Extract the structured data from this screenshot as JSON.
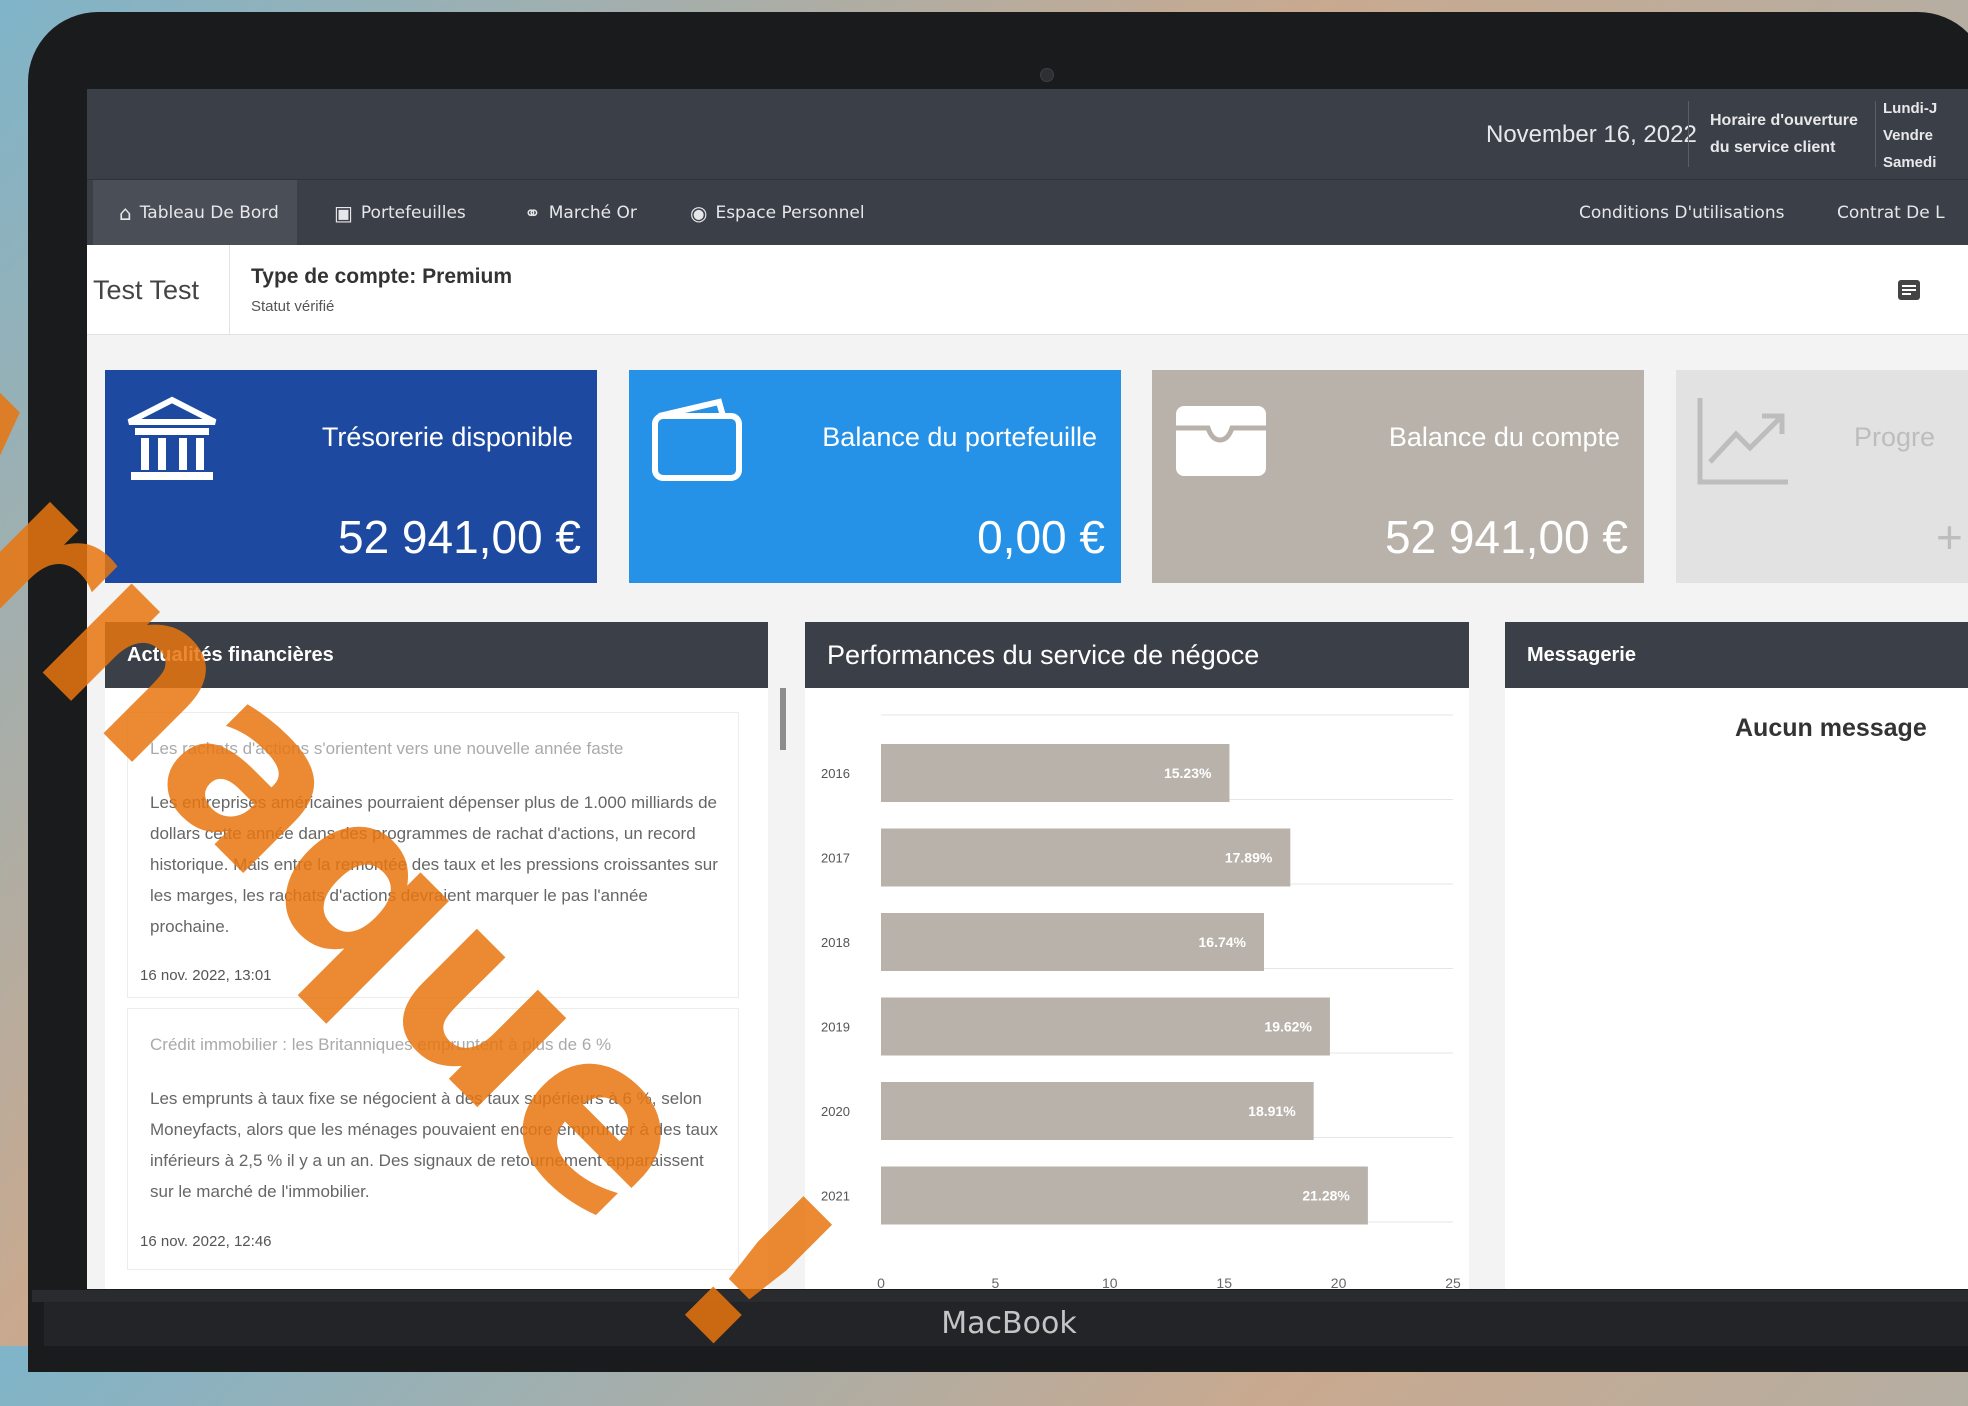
{
  "device_label": "MacBook",
  "header": {
    "date": "November 16, 2022",
    "hours_title": "Horaire d'ouverture du service client",
    "hours_days": [
      "Lundi-J",
      "Vendre",
      "Samedi"
    ]
  },
  "nav": {
    "items": [
      {
        "label": "Tableau De Bord",
        "icon": "home-icon",
        "active": true
      },
      {
        "label": "Portefeuilles",
        "icon": "wallet-icon"
      },
      {
        "label": "Marché Or",
        "icon": "gold-icon"
      },
      {
        "label": "Espace Personnel",
        "icon": "user-circle-icon"
      }
    ],
    "right_items": [
      "Conditions D'utilisations",
      "Contrat De L"
    ]
  },
  "account": {
    "name": "Test Test",
    "type": "Type de compte: Premium",
    "status": "Statut vérifié"
  },
  "cards": [
    {
      "title": "Trésorerie disponible",
      "amount": "52 941,00 €",
      "icon": "bank-icon",
      "color": "#1d4aa0"
    },
    {
      "title": "Balance du portefeuille",
      "amount": "0,00 €",
      "icon": "wallet-icon",
      "color": "#2592e7"
    },
    {
      "title": "Balance du compte",
      "amount": "52 941,00 €",
      "icon": "card-holder-icon",
      "color": "#b8b2aa"
    },
    {
      "title": "Progre",
      "amount": "+",
      "icon": "trend-up-icon",
      "color": "#e2e2e2"
    }
  ],
  "news_panel": {
    "title": "Actualités financières",
    "items": [
      {
        "title": "Les rachats d'actions s'orientent vers une nouvelle année faste",
        "body": "Les entreprises américaines pourraient dépenser plus de 1.000 milliards de dollars cette année dans des programmes de rachat d'actions, un record historique. Mais entre la remontée des taux et les pressions croissantes sur les marges, les rachats d'actions devraient marquer le pas l'année prochaine.",
        "date": "16 nov. 2022, 13:01"
      },
      {
        "title": "Crédit immobilier : les Britanniques empruntent à plus de 6 %",
        "body": "Les emprunts à taux fixe se négocient à des taux supérieurs à 6 %, selon Moneyfacts, alors que les ménages pouvaient encore emprunter à des taux inférieurs à 2,5 % il y a un an. Des signaux de retournement apparaissent sur le marché de l'immobilier.",
        "date": "16 nov. 2022, 12:46"
      }
    ]
  },
  "chart_panel": {
    "title": "Performances du service de négoce"
  },
  "chart_data": {
    "type": "bar",
    "orientation": "horizontal",
    "categories": [
      "2016",
      "2017",
      "2018",
      "2019",
      "2020",
      "2021"
    ],
    "values": [
      15.23,
      17.89,
      16.74,
      19.62,
      18.91,
      21.28
    ],
    "data_labels": [
      "15.23%",
      "17.89%",
      "16.74%",
      "19.62%",
      "18.91%",
      "21.28%"
    ],
    "xlim": [
      0,
      25
    ],
    "xticks": [
      "0",
      "5",
      "10",
      "15",
      "20",
      "25"
    ],
    "bar_color": "#b8b2aa",
    "grid": true
  },
  "messages_panel": {
    "title": "Messagerie",
    "empty_text": "Aucun message"
  },
  "watermark": "Arnaque !"
}
